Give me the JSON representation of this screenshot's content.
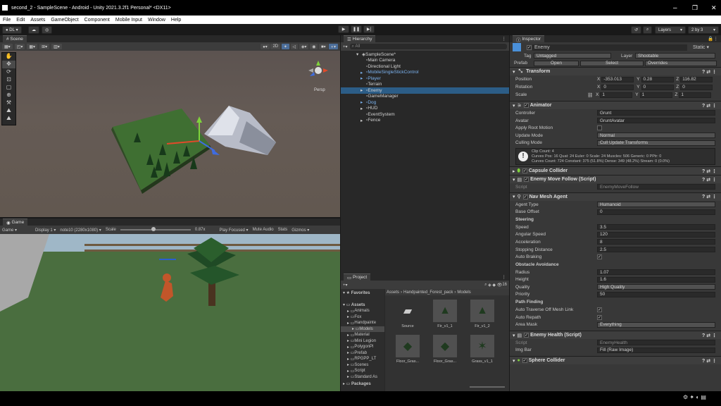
{
  "window": {
    "title": "second_2 - SampleScene - Android - Unity 2021.3.2f1 Personal* <DX11>"
  },
  "menu": [
    "File",
    "Edit",
    "Assets",
    "GameObject",
    "Component",
    "Mobile Input",
    "Window",
    "Help"
  ],
  "toolbar": {
    "account": "DL",
    "layers": "Layers",
    "layout": "2 by 3"
  },
  "scene": {
    "tab": "Scene",
    "mode2d": "2D",
    "persp": "Persp"
  },
  "game": {
    "tab": "Game",
    "mode": "Game",
    "display": "Display 1",
    "resolution": "note10 (2280x1080)",
    "scale_label": "Scale",
    "scale_value": "0.87x",
    "play_focused": "Play Focused",
    "mute": "Mute Audio",
    "stats": "Stats",
    "gizmos": "Gizmos"
  },
  "hierarchy": {
    "tab": "Hierarchy",
    "search": "All",
    "items": [
      {
        "label": "SampleScene*",
        "indent": 0
      },
      {
        "label": "Main Camera",
        "indent": 2
      },
      {
        "label": "Directional Light",
        "indent": 2
      },
      {
        "label": "MobileSingleStickControl",
        "indent": 1
      },
      {
        "label": "Player",
        "indent": 1
      },
      {
        "label": "Terrain",
        "indent": 2
      },
      {
        "label": "Enemy",
        "indent": 1
      },
      {
        "label": "GameManager",
        "indent": 2
      },
      {
        "label": "Dog",
        "indent": 1
      },
      {
        "label": "HUD",
        "indent": 1
      },
      {
        "label": "EventSystem",
        "indent": 2
      },
      {
        "label": "Fence",
        "indent": 1
      }
    ]
  },
  "project": {
    "tab": "Project",
    "count": "16",
    "favorites": "Favorites",
    "assets": "Assets",
    "tree": [
      "Animals",
      "Fox",
      "Handpainte",
      "Models",
      "Material",
      "Mini Legion",
      "PolygonPl",
      "Prefab",
      "RPGPP_LT",
      "Scenes",
      "Script",
      "Standard As"
    ],
    "packages": "Packages",
    "breadcrumb": [
      "Assets",
      "Handpainted_Forest_pack",
      "Models"
    ],
    "files": [
      "Source",
      "Fir_v1_1",
      "Fir_v1_2",
      "Floor_Gras...",
      "Floor_Gras...",
      "Grass_v1_1"
    ]
  },
  "inspector": {
    "tab": "Inspector",
    "name": "Enemy",
    "static": "Static",
    "tag_label": "Tag",
    "tag": "Untagged",
    "layer_label": "Layer",
    "layer": "Shootable",
    "prefab_label": "Prefab",
    "open": "Open",
    "select": "Select",
    "overrides": "Overrides",
    "transform": {
      "title": "Transform",
      "position": "Position",
      "rotation": "Rotation",
      "scale": "Scale",
      "pos": [
        "-353.013",
        "0.28",
        "116.82"
      ],
      "rot": [
        "0",
        "0",
        "0"
      ],
      "scl": [
        "1",
        "1",
        "1"
      ]
    },
    "animator": {
      "title": "Animator",
      "controller_label": "Controller",
      "controller": "Grunt",
      "avatar_label": "Avatar",
      "avatar": "GruntAvatar",
      "root_motion": "Apply Root Motion",
      "update_label": "Update Mode",
      "update": "Normal",
      "culling_label": "Culling Mode",
      "culling": "Cull Update Transforms",
      "info1": "Clip Count: 4",
      "info2": "Curves Pos: 16 Quat: 24 Euler: 0 Scale: 24 Muscles: 506 Generic: 0 PPtr: 0",
      "info3": "Curves Count: 724 Constant: 375 (51.8%) Dense: 349 (48.2%) Stream: 0 (0.0%)"
    },
    "capsule": "Capsule Collider",
    "emf": {
      "title": "Enemy Move Follow (Script)",
      "script_label": "Script",
      "script": "EnemyMoveFollow"
    },
    "nav": {
      "title": "Nav Mesh Agent",
      "agent_type_label": "Agent Type",
      "agent_type": "Humanoid",
      "base_offset_label": "Base Offset",
      "base_offset": "0",
      "steering": "Steering",
      "speed_label": "Speed",
      "speed": "3.5",
      "ang_label": "Angular Speed",
      "ang": "120",
      "acc_label": "Acceleration",
      "acc": "8",
      "stop_label": "Stopping Distance",
      "stop": "2.5",
      "brake_label": "Auto Braking",
      "obstacle": "Obstacle Avoidance",
      "radius_label": "Radius",
      "radius": "1.07",
      "height_label": "Height",
      "height": "1.6",
      "quality_label": "Quality",
      "quality": "High Quality",
      "priority_label": "Priority",
      "priority": "50",
      "pathfinding": "Path Finding",
      "traverse_label": "Auto Traverse Off Mesh Link",
      "repath_label": "Auto Repath",
      "area_label": "Area Mask",
      "area": "Everything"
    },
    "health": {
      "title": "Enemy Health (Script)",
      "script_label": "Script",
      "script": "EnemyHealth",
      "img_label": "Img Bar",
      "img": "Fill (Raw Image)"
    },
    "sphere": "Sphere Collider"
  }
}
